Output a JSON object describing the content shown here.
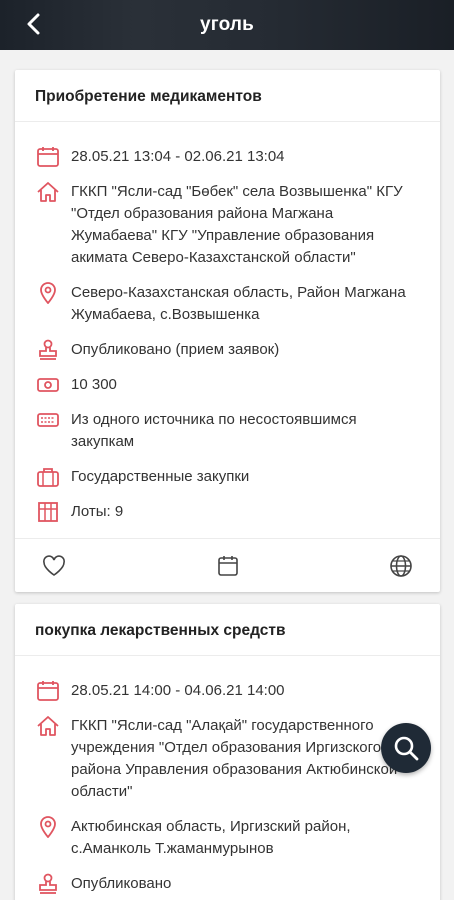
{
  "header": {
    "title": "уголь",
    "back_icon": "arrow-left-icon"
  },
  "colors": {
    "accent": "#e05560",
    "appbar": "#232a33",
    "fab": "#1f2a36"
  },
  "cards": [
    {
      "title": "Приобретение медикаментов",
      "dates": "28.05.21 13:04 - 02.06.21 13:04",
      "organizer": "ГККП \"Ясли-сад \"Бөбек\" села Возвышенка\" КГУ \"Отдел образования района Магжана Жумабаева\" КГУ \"Управление образования акимата Северо-Казахстанской области\"",
      "location": "Северо-Казахстанская область, Район Магжана Жумабаева, с.Возвышенка",
      "status": "Опубликовано (прием заявок)",
      "amount": "10 300",
      "method": "Из одного источника по несостоявшимся закупкам",
      "type": "Государственные закупки",
      "lots": "Лоты: 9"
    },
    {
      "title": "покупка лекарственных средств",
      "dates": "28.05.21 14:00 - 04.06.21 14:00",
      "organizer": "ГККП \"Ясли-сад \"Алақай\" государственного учреждения \"Отдел образования Иргизского района Управления образования Актюбинской области\"",
      "location": "Актюбинская область, Иргизский район, с.Аманколь Т.жаманмурынов",
      "status": "Опубликовано"
    }
  ]
}
